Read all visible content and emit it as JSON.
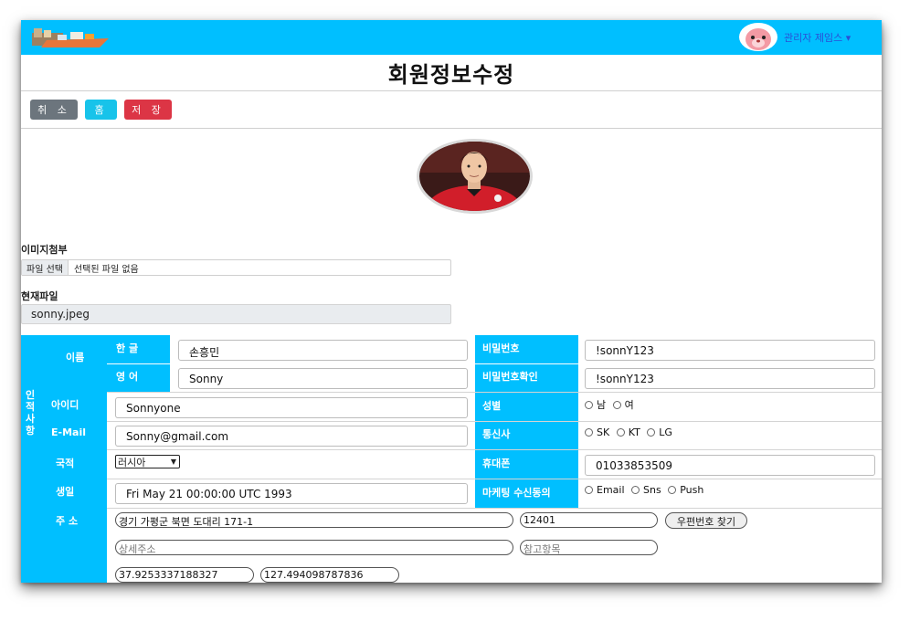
{
  "header": {
    "user_menu": "관리자 제임스 ▾"
  },
  "page": {
    "title": "회원정보수정"
  },
  "buttons": {
    "cancel": "취 소",
    "home": "홈",
    "save": "저 장"
  },
  "image_section": {
    "attach_label": "이미지첨부",
    "file_button": "파일 선택",
    "file_status": "선택된 파일 없음",
    "current_label": "현재파일",
    "current_file": "sonny.jpeg"
  },
  "form": {
    "section_label": "인적사항",
    "name_label": "이름",
    "korean_label": "한 글",
    "korean_value": "손흥민",
    "english_label": "영 어",
    "english_value": "Sonny",
    "id_label": "아이디",
    "id_value": "Sonnyone",
    "email_label": "E-Mail",
    "email_value": "Sonny@gmail.com",
    "country_label": "국적",
    "country_value": "러시아",
    "birth_label": "생일",
    "birth_value": "Fri May 21 00:00:00 UTC 1993",
    "address_label": "주 소",
    "address_value": "경기 가평군 북면 도대리 171-1",
    "zipcode_value": "12401",
    "zip_button": "우편번호 찾기",
    "detail_placeholder": "상세주소",
    "extra_placeholder": "참고항목",
    "lat_value": "37.9253337188327",
    "lng_value": "127.494098787836",
    "password_label": "비밀번호",
    "password_value": "!sonnY123",
    "password_confirm_label": "비밀번호확인",
    "password_confirm_value": "!sonnY123",
    "gender_label": "성별",
    "gender_options": [
      "남",
      "여"
    ],
    "carrier_label": "통신사",
    "carrier_options": [
      "SK",
      "KT",
      "LG"
    ],
    "phone_label": "휴대폰",
    "phone_value": "01033853509",
    "marketing_label": "마케팅 수신동의",
    "marketing_options": [
      "Email",
      "Sns",
      "Push"
    ]
  },
  "colors": {
    "topbar": "#00bfff",
    "label_cell": "#00bfff",
    "cancel": "#6c757d",
    "home": "#17c3ea",
    "save": "#dc3545",
    "user_menu": "#2a4fd6"
  }
}
